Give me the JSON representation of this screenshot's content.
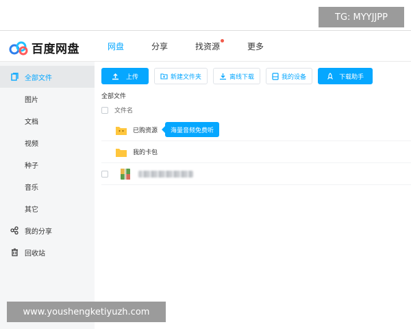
{
  "watermarks": {
    "top_right": "TG: MYYJJPP",
    "bottom_left": "www.youshengketiyuzh.com"
  },
  "app": {
    "name": "百度网盘"
  },
  "nav": [
    {
      "label": "网盘",
      "active": true
    },
    {
      "label": "分享",
      "active": false
    },
    {
      "label": "找资源",
      "active": false,
      "dot": true
    },
    {
      "label": "更多",
      "active": false
    }
  ],
  "sidebar": {
    "all_files": "全部文件",
    "subs": [
      "图片",
      "文档",
      "视频",
      "种子",
      "音乐",
      "其它"
    ],
    "my_share": "我的分享",
    "recycle": "回收站"
  },
  "toolbar": {
    "upload": "上传",
    "new_folder": "新建文件夹",
    "offline_download": "离线下载",
    "my_devices": "我的设备",
    "download_helper": "下载助手"
  },
  "breadcrumb": "全部文件",
  "table": {
    "col_name": "文件名"
  },
  "files": [
    {
      "name": "已购资源"
    },
    {
      "name": "我的卡包"
    }
  ],
  "tooltip": "海量音频免费听",
  "colors": {
    "accent": "#06a7ff",
    "folder": "#ffc63d",
    "dot": "#f15a4a"
  }
}
